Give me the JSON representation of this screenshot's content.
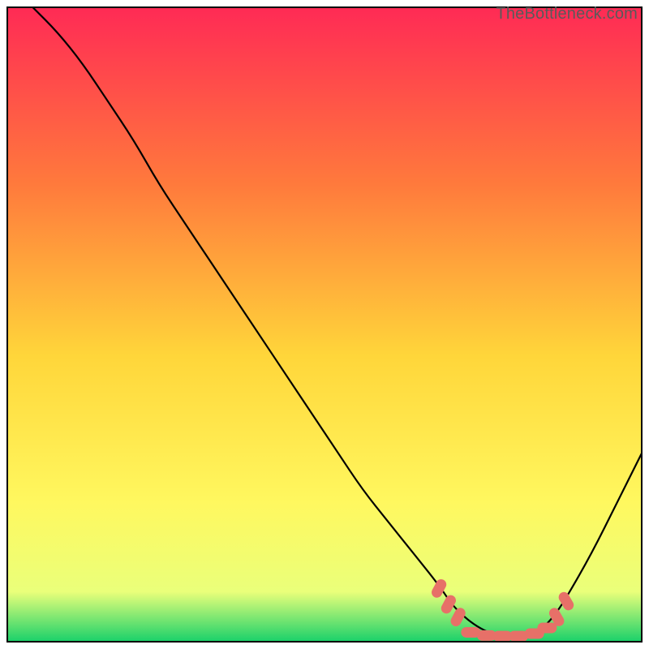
{
  "watermark": "TheBottleneck.com",
  "chart_data": {
    "type": "line",
    "title": "",
    "xlabel": "",
    "ylabel": "",
    "xlim": [
      0,
      100
    ],
    "ylim": [
      0,
      100
    ],
    "series": [
      {
        "name": "curve",
        "x": [
          4,
          8,
          12,
          16,
          20,
          24,
          28,
          32,
          36,
          40,
          44,
          48,
          52,
          56,
          60,
          64,
          68,
          70,
          72,
          74,
          76,
          78,
          80,
          82,
          84,
          86,
          88,
          92,
          96,
          100
        ],
        "y": [
          100,
          96,
          91,
          85,
          79,
          72,
          66,
          60,
          54,
          48,
          42,
          36,
          30,
          24,
          19,
          14,
          9,
          6,
          4,
          2.5,
          1.5,
          1,
          1,
          1.2,
          2,
          4,
          7,
          14,
          22,
          30
        ]
      }
    ],
    "marker_clusters": [
      {
        "name": "bottom-left-dots",
        "x_range": [
          68,
          72
        ],
        "y_range": [
          3,
          9
        ]
      },
      {
        "name": "bottom-flat-dots",
        "x_range": [
          72,
          86
        ],
        "y_range": [
          0.8,
          3
        ]
      },
      {
        "name": "bottom-right-dots",
        "x_range": [
          85,
          89
        ],
        "y_range": [
          3,
          8
        ]
      }
    ],
    "colors": {
      "gradient_top": "#ff2a55",
      "gradient_mid_upper": "#ff7a3c",
      "gradient_mid": "#ffd63a",
      "gradient_mid_lower": "#fff85f",
      "gradient_low": "#eaff7a",
      "gradient_bottom": "#16d06a",
      "curve": "#000000",
      "dot_fill": "#e77068",
      "dot_stroke": "#b84a45",
      "frame": "#000000"
    }
  }
}
